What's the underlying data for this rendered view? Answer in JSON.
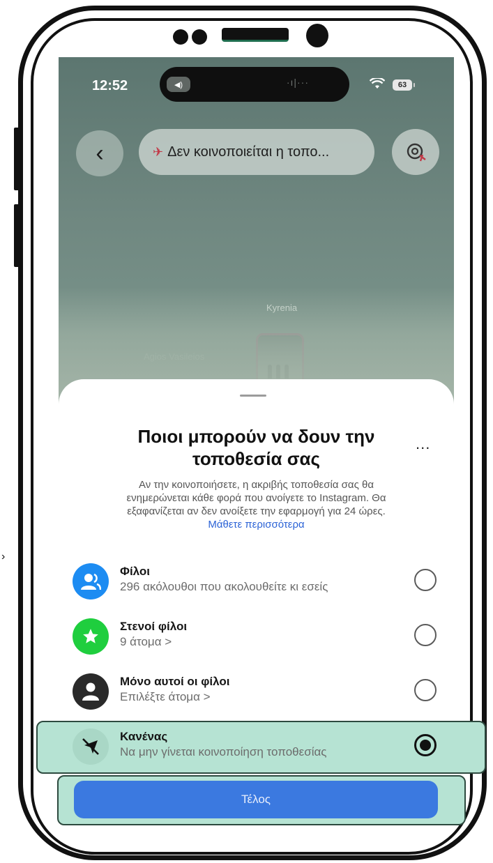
{
  "status_bar": {
    "time": "12:52",
    "battery": "63",
    "volume_glyph": "◀)",
    "signal_glyph": "·ı|···"
  },
  "top_bar": {
    "back_glyph": "‹",
    "location_status": "Δεν κοινοποιείται η τοπο...",
    "status_icon": "✈"
  },
  "map": {
    "labels": [
      "Kyrenia",
      "Agios Vasileios"
    ]
  },
  "sheet": {
    "title_line_1": "Ποιοι μπορούν να δουν την",
    "title_line_2": "τοποθεσία σας",
    "more_glyph": "...",
    "description_line_1": "Αν την κοινοποιήσετε, η ακριβής τοποθεσία σας θα",
    "description_line_2": "ενημερώνεται κάθε φορά που ανοίγετε το Instagram. Θα",
    "description_line_3": "εξαφανίζεται αν δεν ανοίξετε την εφαρμογή για 24 ώρες.",
    "learn_more": "Μάθετε περισσότερα",
    "options": [
      {
        "title": "Φίλοι",
        "subtitle": "296 ακόλουθοι που ακολουθείτε κι εσείς",
        "icon": "friends-icon",
        "color": "#1d8cf2",
        "selected": false
      },
      {
        "title": "Στενοί φίλοι",
        "subtitle": "9 άτομα >",
        "icon": "star-icon",
        "color": "#1fce3e",
        "selected": false
      },
      {
        "title": "Μόνο αυτοί οι φίλοι",
        "subtitle": "Επιλέξτε άτομα >",
        "icon": "person-icon",
        "color": "#2a2a2a",
        "selected": false
      },
      {
        "title": "Κανένας",
        "subtitle": "Να μην γίνεται κοινοποίηση τοποθεσίας",
        "icon": "location-off-icon",
        "color": "#a9d7c6",
        "selected": true
      }
    ],
    "done_label": "Τέλος"
  },
  "colors": {
    "highlight": "#b6e3d3",
    "done_button": "#3b79e0",
    "link": "#2c63d6"
  }
}
